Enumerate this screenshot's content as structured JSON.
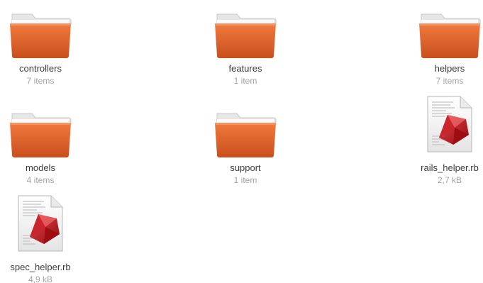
{
  "items": [
    {
      "name": "controllers",
      "meta": "7 items",
      "type": "folder",
      "icon": "folder-icon"
    },
    {
      "name": "features",
      "meta": "1 item",
      "type": "folder",
      "icon": "folder-icon"
    },
    {
      "name": "helpers",
      "meta": "7 items",
      "type": "folder",
      "icon": "folder-icon"
    },
    {
      "name": "models",
      "meta": "4 items",
      "type": "folder",
      "icon": "folder-icon"
    },
    {
      "name": "support",
      "meta": "1 item",
      "type": "folder",
      "icon": "folder-icon"
    },
    {
      "name": "rails_helper.rb",
      "meta": "2,7 kB",
      "type": "file",
      "icon": "ruby-file-icon"
    },
    {
      "name": "spec_helper.rb",
      "meta": "4,9 kB",
      "type": "file",
      "icon": "ruby-file-icon"
    }
  ],
  "colors": {
    "folder_orange": "#e0652a",
    "folder_tab": "#f2f2f2",
    "ruby_red": "#b8141a",
    "label_text": "#3c3c3c",
    "meta_text": "#a4a4a4"
  }
}
